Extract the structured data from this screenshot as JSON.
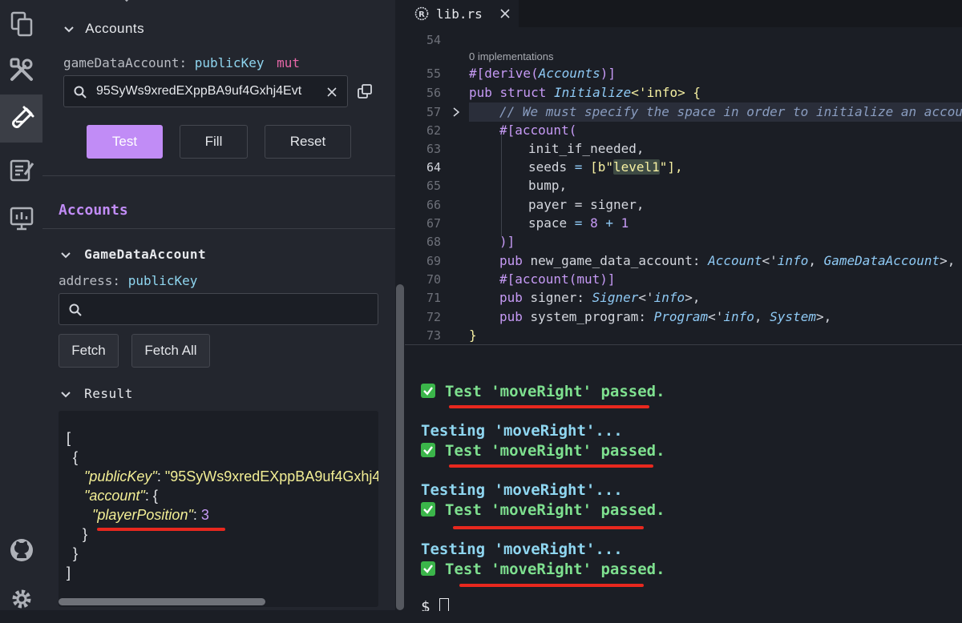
{
  "sidebar": {
    "icons": [
      "files-icon",
      "tools-icon",
      "test-tube-icon",
      "notes-icon",
      "deploy-icon",
      "github-icon",
      "settings-icon"
    ]
  },
  "panel": {
    "accounts_section_title": "Accounts",
    "game_data_account_label": "gameDataAccount:",
    "game_data_account_type": "publicKey",
    "game_data_account_mut": "mut",
    "search_value": "95SyWs9xredEXppBA9uf4Gxhj4Evt",
    "buttons": {
      "test": "Test",
      "fill": "Fill",
      "reset": "Reset"
    },
    "accounts_heading": "Accounts",
    "game_data_section": "GameDataAccount",
    "address_label": "address:",
    "address_type": "publicKey",
    "address_placeholder": "",
    "fetch_buttons": {
      "fetch": "Fetch",
      "fetch_all": "Fetch All"
    },
    "result_title": "Result",
    "result_json": {
      "open_bracket": "[",
      "open_brace": "{",
      "pubkey_key": "\"publicKey\"",
      "pubkey_value": "\"95SyWs9xredEXppBA9uf4Gxhj4",
      "account_key": "\"account\"",
      "account_open": "{",
      "player_key": "\"playerPosition\"",
      "player_value": "3",
      "close_inner": "}",
      "close_brace": "}",
      "close_bracket": "]"
    }
  },
  "editor": {
    "tab_title": "lib.rs",
    "implementations_hint": "0 implementations",
    "lines": [
      {
        "num": "54"
      },
      {
        "num": "55"
      },
      {
        "num": "56"
      },
      {
        "num": "57"
      },
      {
        "num": "62"
      },
      {
        "num": "63"
      },
      {
        "num": "64"
      },
      {
        "num": "65"
      },
      {
        "num": "66"
      },
      {
        "num": "67"
      },
      {
        "num": "68"
      },
      {
        "num": "69"
      },
      {
        "num": "70"
      },
      {
        "num": "71"
      },
      {
        "num": "72"
      },
      {
        "num": "73"
      }
    ],
    "code": {
      "l55_hash": "#[",
      "l55_derive": "derive(",
      "l55_accounts": "Accounts",
      "l55_close": ")]",
      "l56_pub": "pub ",
      "l56_struct": "struct ",
      "l56_name": "Initialize",
      "l56_rest": "<'info> {",
      "l57_comment": "// We must specify the space in order to initialize an account",
      "l62": "#[account(",
      "l63": "init_if_needed,",
      "l64_seeds": "seeds",
      "l64_eq": " = ",
      "l64_open": "[b\"",
      "l64_level": "level1",
      "l64_close": "\"],",
      "l65": "bump,",
      "l66_payer": "payer",
      "l66_rest": " = signer,",
      "l67_space": "space",
      "l67_eq": " = ",
      "l67_8": "8",
      "l67_plus": " + ",
      "l67_1": "1",
      "l68": ")]",
      "l69_pub": "pub ",
      "l69_field": "new_game_data_account: ",
      "l69_ty": "Account",
      "l69_lt": "<'",
      "l69_info": "info",
      "l69_comma": ", ",
      "l69_gda": "GameDataAccount",
      "l69_end": ">,",
      "l70": "#[account(mut)]",
      "l71_pub": "pub ",
      "l71_field": "signer: ",
      "l71_ty": "Signer",
      "l71_lt": "<'",
      "l71_info": "info",
      "l71_end": ">,",
      "l72_pub": "pub ",
      "l72_field": "system_program: ",
      "l72_ty": "Program",
      "l72_lt": "<'",
      "l72_info": "info",
      "l72_comma": ", ",
      "l72_sys": "System",
      "l72_end": ">,",
      "l73": "}"
    }
  },
  "terminal": {
    "pass1": "Test 'moveRight' passed.",
    "testing2": "Testing 'moveRight'...",
    "pass2": "Test 'moveRight' passed.",
    "testing3": "Testing 'moveRight'...",
    "pass3": "Test 'moveRight' passed.",
    "testing4": "Testing 'moveRight'...",
    "pass4": "Test 'moveRight' passed.",
    "prompt": "$"
  },
  "colors": {
    "accent": "#c18cf6",
    "pass_green": "#7ee08f",
    "annotation_red": "#e8281e"
  }
}
